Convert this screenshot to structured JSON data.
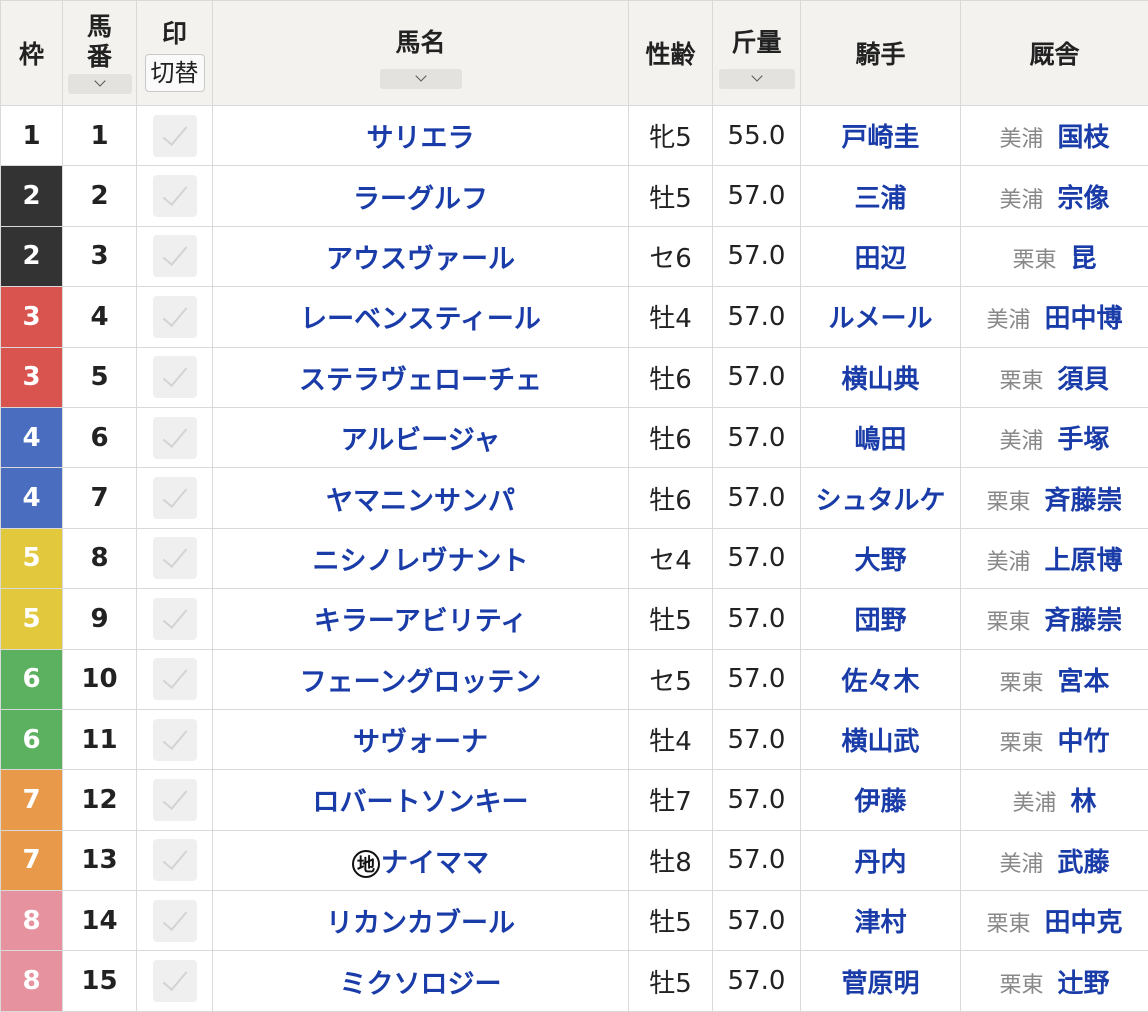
{
  "header": {
    "waku": "枠",
    "umaban_line1": "馬",
    "umaban_line2": "番",
    "mark": "印",
    "mark_switch": "切替",
    "horse_name": "馬名",
    "sex_age": "性齢",
    "weight": "斤量",
    "jockey": "騎手",
    "stable": "厩舎"
  },
  "colors": {
    "waku_1": "#ffffff",
    "waku_2": "#333333",
    "waku_3": "#d9534f",
    "waku_4": "#4a6dbf",
    "waku_5": "#e2c83c",
    "waku_6": "#5cb160",
    "waku_7": "#e89a4a",
    "waku_8": "#e7939f",
    "link_blue": "#1a3ca8"
  },
  "rows": [
    {
      "waku": "1",
      "umaban": "1",
      "name": "サリエラ",
      "local": "",
      "sex_age": "牝5",
      "weight": "55.0",
      "jockey": "戸崎圭",
      "region": "美浦",
      "trainer": "国枝"
    },
    {
      "waku": "2",
      "umaban": "2",
      "name": "ラーグルフ",
      "local": "",
      "sex_age": "牡5",
      "weight": "57.0",
      "jockey": "三浦",
      "region": "美浦",
      "trainer": "宗像"
    },
    {
      "waku": "2",
      "umaban": "3",
      "name": "アウスヴァール",
      "local": "",
      "sex_age": "セ6",
      "weight": "57.0",
      "jockey": "田辺",
      "region": "栗東",
      "trainer": "昆"
    },
    {
      "waku": "3",
      "umaban": "4",
      "name": "レーベンスティール",
      "local": "",
      "sex_age": "牡4",
      "weight": "57.0",
      "jockey": "ルメール",
      "region": "美浦",
      "trainer": "田中博"
    },
    {
      "waku": "3",
      "umaban": "5",
      "name": "ステラヴェローチェ",
      "local": "",
      "sex_age": "牡6",
      "weight": "57.0",
      "jockey": "横山典",
      "region": "栗東",
      "trainer": "須貝"
    },
    {
      "waku": "4",
      "umaban": "6",
      "name": "アルビージャ",
      "local": "",
      "sex_age": "牡6",
      "weight": "57.0",
      "jockey": "嶋田",
      "region": "美浦",
      "trainer": "手塚"
    },
    {
      "waku": "4",
      "umaban": "7",
      "name": "ヤマニンサンパ",
      "local": "",
      "sex_age": "牡6",
      "weight": "57.0",
      "jockey": "シュタルケ",
      "region": "栗東",
      "trainer": "斉藤崇"
    },
    {
      "waku": "5",
      "umaban": "8",
      "name": "ニシノレヴナント",
      "local": "",
      "sex_age": "セ4",
      "weight": "57.0",
      "jockey": "大野",
      "region": "美浦",
      "trainer": "上原博"
    },
    {
      "waku": "5",
      "umaban": "9",
      "name": "キラーアビリティ",
      "local": "",
      "sex_age": "牡5",
      "weight": "57.0",
      "jockey": "団野",
      "region": "栗東",
      "trainer": "斉藤崇"
    },
    {
      "waku": "6",
      "umaban": "10",
      "name": "フェーングロッテン",
      "local": "",
      "sex_age": "セ5",
      "weight": "57.0",
      "jockey": "佐々木",
      "region": "栗東",
      "trainer": "宮本"
    },
    {
      "waku": "6",
      "umaban": "11",
      "name": "サヴォーナ",
      "local": "",
      "sex_age": "牡4",
      "weight": "57.0",
      "jockey": "横山武",
      "region": "栗東",
      "trainer": "中竹"
    },
    {
      "waku": "7",
      "umaban": "12",
      "name": "ロバートソンキー",
      "local": "",
      "sex_age": "牡7",
      "weight": "57.0",
      "jockey": "伊藤",
      "region": "美浦",
      "trainer": "林"
    },
    {
      "waku": "7",
      "umaban": "13",
      "name": "ナイママ",
      "local": "地",
      "sex_age": "牡8",
      "weight": "57.0",
      "jockey": "丹内",
      "region": "美浦",
      "trainer": "武藤"
    },
    {
      "waku": "8",
      "umaban": "14",
      "name": "リカンカブール",
      "local": "",
      "sex_age": "牡5",
      "weight": "57.0",
      "jockey": "津村",
      "region": "栗東",
      "trainer": "田中克"
    },
    {
      "waku": "8",
      "umaban": "15",
      "name": "ミクソロジー",
      "local": "",
      "sex_age": "牡5",
      "weight": "57.0",
      "jockey": "菅原明",
      "region": "栗東",
      "trainer": "辻野"
    }
  ]
}
